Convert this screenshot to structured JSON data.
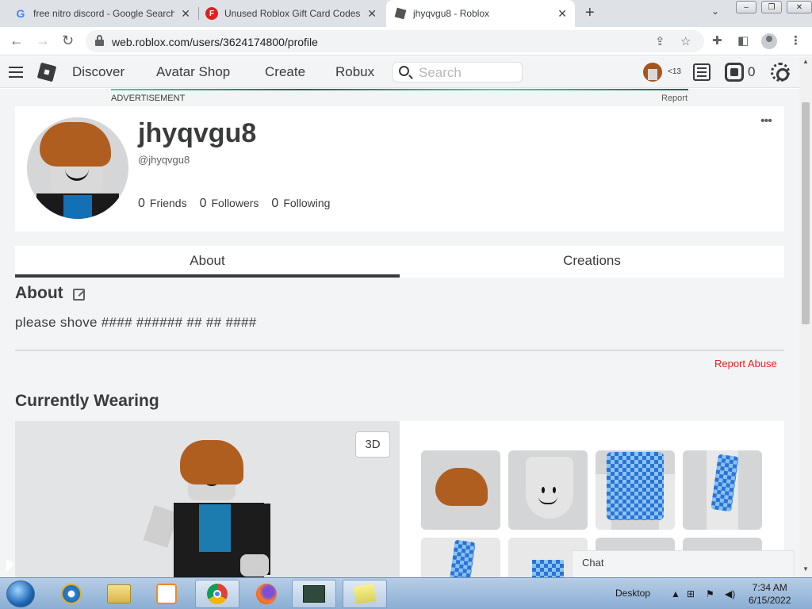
{
  "browser": {
    "tabs": [
      {
        "title": "free nitro discord - Google Search",
        "active": false
      },
      {
        "title": "Unused Roblox Gift Card Codes",
        "active": false
      },
      {
        "title": "jhyqvgu8 - Roblox",
        "active": true
      }
    ],
    "url": "web.roblox.com/users/3624174800/profile"
  },
  "header": {
    "nav": [
      "Discover",
      "Avatar Shop",
      "Create",
      "Robux"
    ],
    "search_placeholder": "Search",
    "age_badge": "<13",
    "robux_balance": "0"
  },
  "ad": {
    "label": "ADVERTISEMENT",
    "report": "Report"
  },
  "profile": {
    "display_name": "jhyqvgu8",
    "handle": "@jhyqvgu8",
    "stats": [
      {
        "count": "0",
        "label": "Friends"
      },
      {
        "count": "0",
        "label": "Followers"
      },
      {
        "count": "0",
        "label": "Following"
      }
    ],
    "more": "•••"
  },
  "profile_tabs": [
    "About",
    "Creations"
  ],
  "about": {
    "title": "About",
    "text": "please shove #### ###### ## ## ####",
    "report_abuse": "Report Abuse"
  },
  "wearing": {
    "title": "Currently Wearing",
    "btn_3d": "3D",
    "items": [
      "hair",
      "head",
      "shirt",
      "sleeve",
      "shirt-partial",
      "shirt-partial",
      "item",
      "item"
    ]
  },
  "chat": {
    "label": "Chat"
  },
  "taskbar": {
    "desktop": "Desktop",
    "time": "7:34 AM",
    "date": "6/15/2022"
  },
  "colors": {
    "roblox_bg": "#f2f4f5",
    "text": "#393b3d",
    "report_red": "#e2231a"
  }
}
